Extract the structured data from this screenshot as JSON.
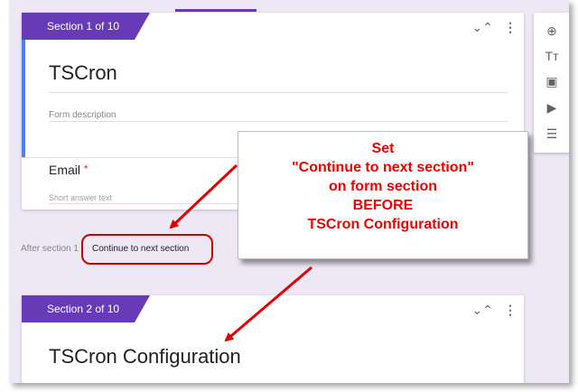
{
  "sections": [
    {
      "tab_label": "Section 1 of 10",
      "title": "TSCron",
      "description_placeholder": "Form description",
      "question": {
        "title": "Email",
        "required_mark": "*",
        "answer_placeholder": "Short answer text"
      }
    },
    {
      "tab_label": "Section 2 of 10",
      "title": "TSCron Configuration"
    }
  ],
  "after_section": {
    "label": "After section 1",
    "selected": "Continue to next section"
  },
  "controls": {
    "collapse_glyph": "⌄⌃",
    "more_glyph": "⋮"
  },
  "toolbar": {
    "add_question_glyph": "⊕",
    "add_title_glyph": "Tт",
    "add_image_glyph": "▣",
    "add_video_glyph": "▶",
    "add_section_glyph": "☰"
  },
  "callout": {
    "lines": [
      "Set",
      "\"Continue to next section\"",
      "on form section",
      "BEFORE",
      "TSCron Configuration"
    ]
  },
  "colors": {
    "accent": "#673ab7",
    "background": "#ede7f6",
    "annotation": "#ee0000"
  }
}
